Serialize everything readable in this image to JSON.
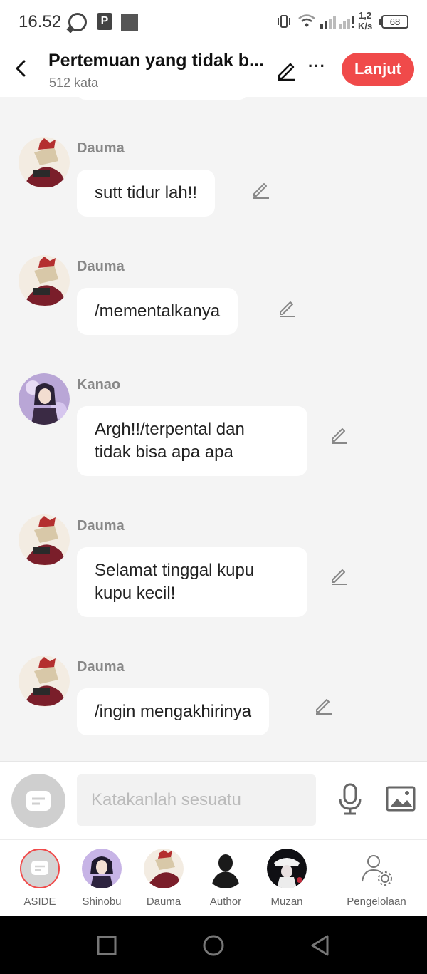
{
  "status_bar": {
    "time": "16.52",
    "speed_top": "1,2",
    "speed_bottom": "K/s",
    "battery": "68"
  },
  "header": {
    "title": "Pertemuan yang tidak b...",
    "word_count": "512 kata",
    "next_label": "Lanjut"
  },
  "messages": [
    {
      "sender": "Dauma",
      "text": "sutt tidur lah!!"
    },
    {
      "sender": "Dauma",
      "text": "/mementalkanya"
    },
    {
      "sender": "Kanao",
      "text_line1": "Argh!!/terpental dan",
      "text_line2": "tidak bisa apa apa"
    },
    {
      "sender": "Dauma",
      "text_line1": "Selamat tinggal kupu",
      "text_line2": "kupu kecil!"
    },
    {
      "sender": "Dauma",
      "text": "/ingin mengakhirinya"
    }
  ],
  "input": {
    "placeholder": "Katakanlah sesuatu"
  },
  "characters": [
    {
      "label": "ASIDE"
    },
    {
      "label": "Shinobu"
    },
    {
      "label": "Dauma"
    },
    {
      "label": "Author"
    },
    {
      "label": "Muzan"
    },
    {
      "label": "Pengelolaan"
    }
  ],
  "colors": {
    "accent": "#f04a4a",
    "background": "#f4f4f4",
    "bubble": "#ffffff"
  }
}
